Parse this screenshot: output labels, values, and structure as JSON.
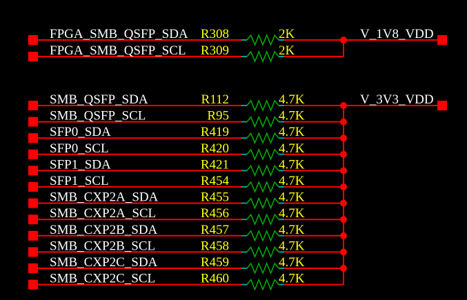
{
  "colors": {
    "background": "#000000",
    "wire": "#ff0000",
    "pin_wire": "#00a0a0",
    "resistor": "#00b000",
    "net_label": "#ffffff",
    "designator": "#ffff00",
    "value": "#ffff00"
  },
  "groups": [
    {
      "rail": "V_1V8_VDD",
      "resistors": [
        {
          "net": "FPGA_SMB_QSFP_SDA",
          "ref": "R308",
          "value": "2K"
        },
        {
          "net": "FPGA_SMB_QSFP_SCL",
          "ref": "R309",
          "value": "2K"
        }
      ]
    },
    {
      "rail": "V_3V3_VDD",
      "resistors": [
        {
          "net": "SMB_QSFP_SDA",
          "ref": "R112",
          "value": "4.7K"
        },
        {
          "net": "SMB_QSFP_SCL",
          "ref": "R95",
          "value": "4.7K"
        },
        {
          "net": "SFP0_SDA",
          "ref": "R419",
          "value": "4.7K"
        },
        {
          "net": "SFP0_SCL",
          "ref": "R420",
          "value": "4.7K"
        },
        {
          "net": "SFP1_SDA",
          "ref": "R421",
          "value": "4.7K"
        },
        {
          "net": "SFP1_SCL",
          "ref": "R454",
          "value": "4.7K"
        },
        {
          "net": "SMB_CXP2A_SDA",
          "ref": "R455",
          "value": "4.7K"
        },
        {
          "net": "SMB_CXP2A_SCL",
          "ref": "R456",
          "value": "4.7K"
        },
        {
          "net": "SMB_CXP2B_SDA",
          "ref": "R457",
          "value": "4.7K"
        },
        {
          "net": "SMB_CXP2B_SCL",
          "ref": "R458",
          "value": "4.7K"
        },
        {
          "net": "SMB_CXP2C_SDA",
          "ref": "R459",
          "value": "4.7K"
        },
        {
          "net": "SMB_CXP2C_SCL",
          "ref": "R460",
          "value": "4.7K"
        }
      ]
    }
  ]
}
